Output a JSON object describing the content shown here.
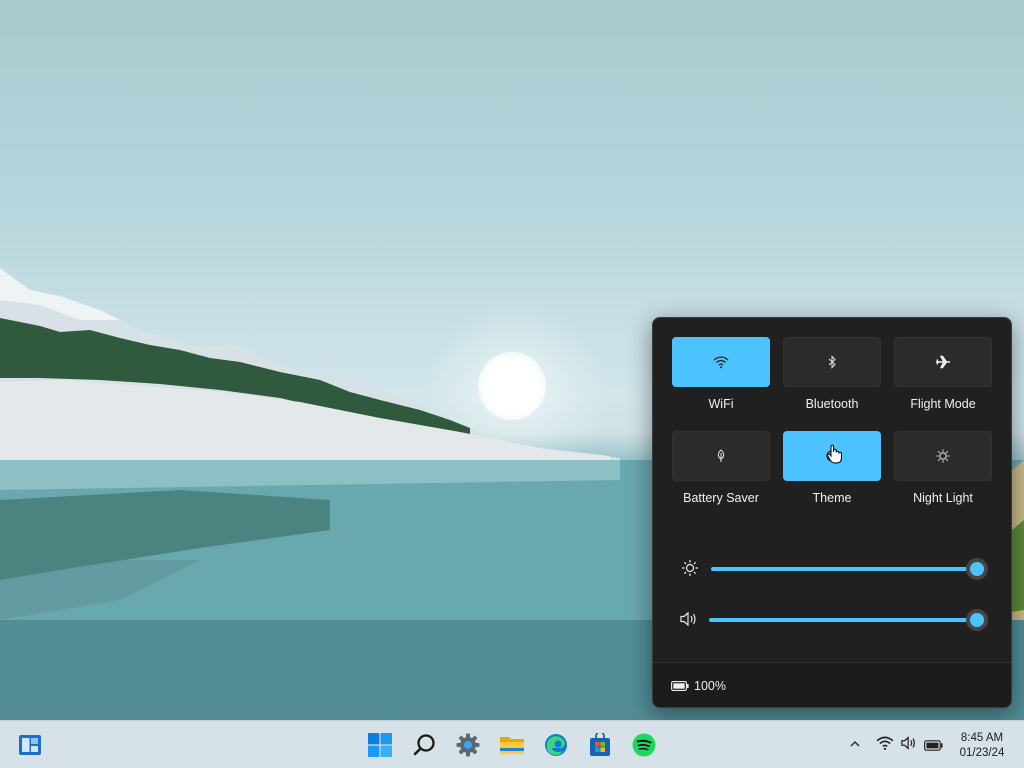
{
  "quick_settings": {
    "tiles": [
      {
        "label": "WiFi",
        "icon": "wifi-icon",
        "active": true
      },
      {
        "label": "Bluetooth",
        "icon": "bluetooth-icon",
        "active": false
      },
      {
        "label": "Flight Mode",
        "icon": "airplane-icon",
        "active": false
      },
      {
        "label": "Battery Saver",
        "icon": "battery-saver-icon",
        "active": false
      },
      {
        "label": "Theme",
        "icon": "theme-icon",
        "active": true
      },
      {
        "label": "Night Light",
        "icon": "night-light-icon",
        "active": false
      }
    ],
    "brightness": {
      "icon": "brightness-icon",
      "value": 1.0
    },
    "volume": {
      "icon": "volume-icon",
      "value": 1.0
    },
    "battery": {
      "icon": "battery-icon",
      "label": "100%"
    }
  },
  "taskbar": {
    "widgets_icon": "widgets-icon",
    "apps": [
      "windows-start-icon",
      "search-icon",
      "settings-icon",
      "file-explorer-icon",
      "edge-icon",
      "store-icon",
      "spotify-icon"
    ],
    "tray": [
      "chevron-up-icon",
      "wifi-icon",
      "volume-icon",
      "battery-icon"
    ],
    "clock": {
      "time": "8:45 AM",
      "date": "01/23/24"
    }
  },
  "colors": {
    "accent": "#4cc2ff",
    "panel": "#202020",
    "tile": "#2b2b2b",
    "taskbar": "#d7e1e8"
  }
}
